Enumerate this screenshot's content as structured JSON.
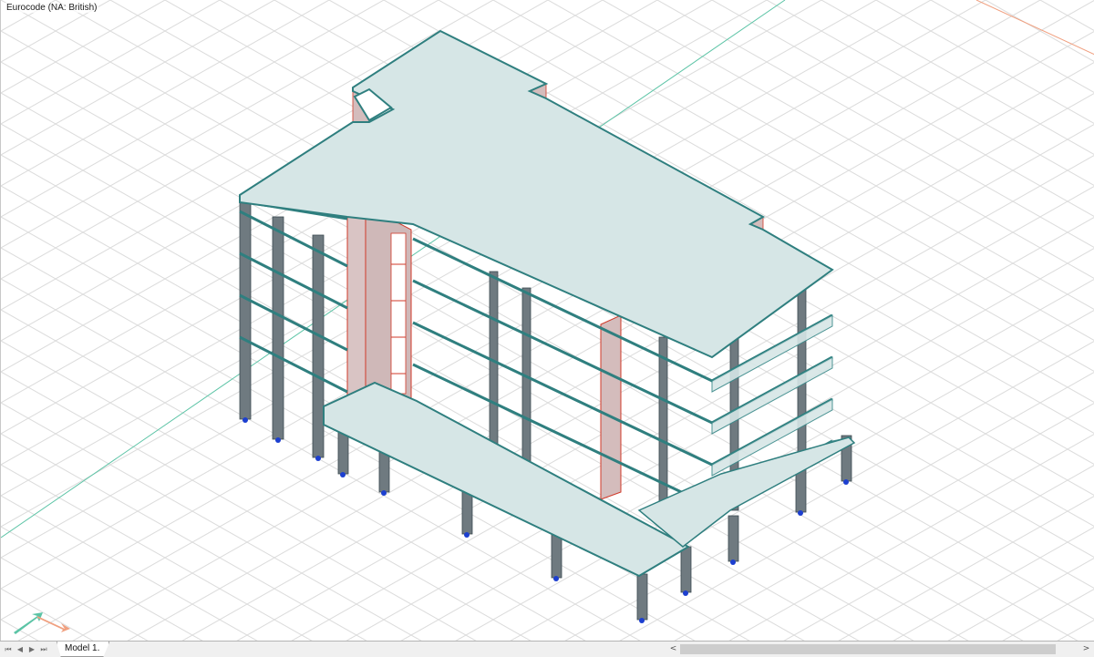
{
  "viewport": {
    "code_label": "Eurocode (NA: British)",
    "colors": {
      "grid": "#d9d9d9",
      "slab_fill": "#d6e6e6",
      "slab_edge": "#3a8a8a",
      "beam": "#2f7f7f",
      "column": "#6f7a80",
      "wall": "#cfb8b8",
      "wall_edge": "#d03a2a",
      "support": "#1c3fd0",
      "axis_green": "#5cc4a6",
      "axis_orange": "#f0a080"
    },
    "icons": {
      "axis_triad": "axis-triad-icon"
    }
  },
  "bottom_bar": {
    "nav": {
      "first": "⏮",
      "prev": "◀",
      "next": "▶",
      "last": "⏭"
    },
    "sheet_tab": "Model 1.",
    "scroll_left": "<",
    "scroll_right": ">"
  }
}
